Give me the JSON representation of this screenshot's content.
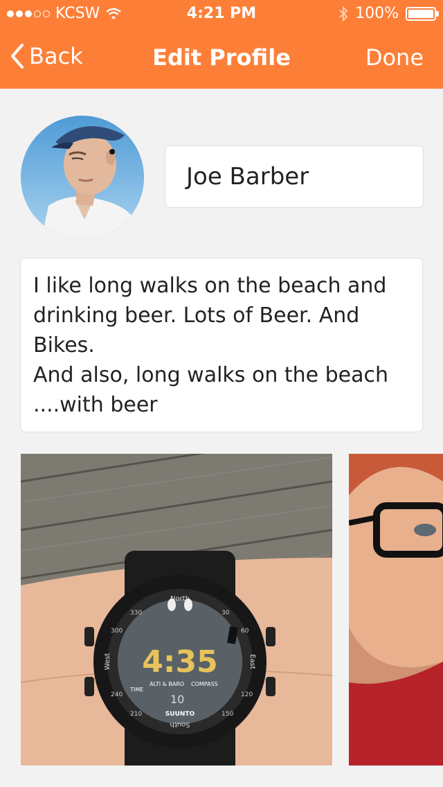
{
  "status_bar": {
    "carrier": "KCSW",
    "time": "4:21 PM",
    "battery": "100%",
    "signal_bars": 5,
    "signal_filled": 3
  },
  "nav": {
    "back_label": "Back",
    "title": "Edit Profile",
    "done_label": "Done"
  },
  "profile": {
    "name": "Joe Barber",
    "bio": "I like long walks on the beach and\ndrinking beer. Lots of Beer. And Bikes.\nAnd also, long walks on the beach\n....with beer"
  },
  "photos": [
    {
      "subject": "wrist-watch",
      "watch": {
        "brand": "SUUNTO",
        "time_display": "4:35",
        "labels": [
          "North",
          "East",
          "South",
          "West",
          "TIME",
          "ALTI & BARO",
          "COMPASS",
          "10"
        ],
        "bezel": [
          "330",
          "30",
          "60",
          "120",
          "150",
          "210",
          "240",
          "300"
        ]
      }
    },
    {
      "subject": "man-with-glasses"
    }
  ],
  "colors": {
    "accent": "#fd7f37",
    "background": "#f2f2f2",
    "field_bg": "#ffffff"
  }
}
